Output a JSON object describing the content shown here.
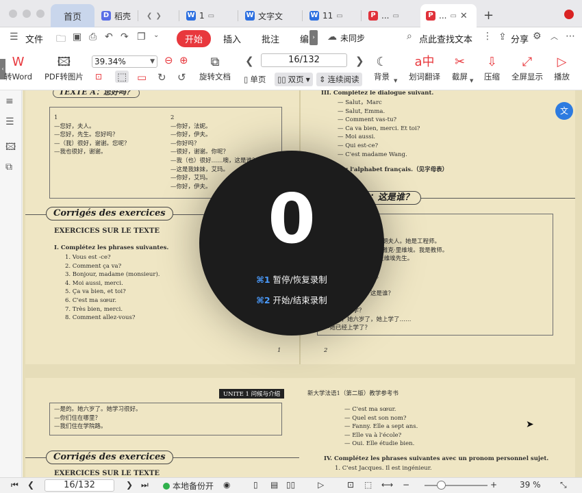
{
  "tabs": {
    "home": "首页",
    "daoke": "稻壳",
    "doc1": "1",
    "doc2": "文字文",
    "doc3": "11",
    "pdf1": "...",
    "pdf2": "...",
    "doc1_badge": "W",
    "doc2_badge": "W",
    "doc3_badge": "W",
    "pdf1_badge": "P",
    "pdf2_badge": "P",
    "daoke_badge": "D",
    "close": "✕",
    "new_tab": "+"
  },
  "menubar": {
    "file": "文件",
    "start": "开始",
    "insert": "插入",
    "annotate": "批注",
    "edit": "编",
    "sync": "未同步",
    "search": "点此查找文本",
    "share": "分享"
  },
  "ribbon": {
    "to_word": "转Word",
    "pdf_to_image": "PDF转图片",
    "zoom": "39.34%",
    "rotate_doc": "旋转文档",
    "page_indicator": "16/132",
    "single_page": "单页",
    "double_page": "双页",
    "continuous": "连续阅读",
    "background": "背景",
    "translate": "划词翻译",
    "screenshot": "截屏",
    "compress": "压缩",
    "fullscreen": "全屏显示",
    "play": "播放"
  },
  "document": {
    "left": {
      "header": "TEXTE A：您好吗？",
      "col1": [
        "1",
        "—您好，夫人。",
        "—您好，先生。您好吗？",
        "—（我）很好，谢谢。您呢？",
        "—我也很好，谢谢。"
      ],
      "col2": [
        "2",
        "—你好，法妮。",
        "—你好，伊夫。",
        "—你好吗？",
        "—很好，谢谢。你呢？",
        "—我（也）很好……噢，这是谁？",
        "—这是我妹妹，艾玛。",
        "—你好，艾玛。",
        "—你好，伊夫。"
      ],
      "banner": "Corrigés des exercices",
      "section": "EXERCICES SUR LE TEXTE",
      "exercise_title": "I.   Complétez les phrases suivantes.",
      "items": [
        "1.  Vous est -ce?",
        "2.  Comment ça va?",
        "3. Bonjour, madame (monsieur).",
        "4.  Moi aussi, merci.",
        "5.  Ça va bien, et toi?",
        "6.  C'est ma sœur.",
        "7.  Très bien, merci.",
        "8.  Comment allez-vous?"
      ],
      "page_no": "1"
    },
    "right": {
      "heading": "III.  Complétez le dialogue suivant.",
      "dialogue": [
        "— Salut，Marc",
        "— Salut, Emma.",
        "— Comment vas-tu?",
        "— Ca va bien, merci. Et toi?",
        "— Moi aussi.",
        "— Qui est-ce?",
        "— C'est  madame Wang."
      ],
      "iv": "IV.   Lisez l'alphabet français.（见字母表）",
      "banner": "TEXTE B：这是谁？",
      "box_lines": [
        "1",
        "—这是谁？",
        "—这是……（夫人）杜朗夫人。她是工程师。",
        "—这是谁？（这）是玛雅克·里维埃。我是教师。",
        "—你好，她是玛雅克·里维埃先生。",
        "2",
        "—您好，先生。你好。",
        "—请问，这是谁？",
        "—这是……（是）这是谁？",
        "—她是学……",
        "—她是什么学？",
        "—是的，她六岁了，她上学了……",
        "—她已经上学了？"
      ],
      "page_no": "2"
    },
    "lower": {
      "unit": "UNITE 1   问候与介绍",
      "book": "新大学法语1（第二版）教学参考书",
      "box_lines": [
        "—是的。她六岁了。她学习很好。",
        "—你们住在哪里？",
        "—我们住在学院路。"
      ],
      "banner": "Corrigés des exercices",
      "section": "EXERCICES SUR LE TEXTE",
      "right_lines": [
        "— C'est ma sœur.",
        "— Quel est son nom?",
        "— Fanny. Elle a sept ans.",
        "— Elle va à l'école?",
        "— Oui. Elle étudie bien."
      ],
      "iv": "IV.  Complétez les phrases suivantes avec un pronom personnel sujet.",
      "iv1": "1.  C'est Jacques. Il est ingénieur."
    }
  },
  "overlay": {
    "countdown": "0",
    "shortcut1_key": "⌘1",
    "shortcut1_label": "暂停/恢复录制",
    "shortcut2_key": "⌘2",
    "shortcut2_label": "开始/结束录制"
  },
  "statusbar": {
    "page": "16/132",
    "backup": "本地备份开",
    "zoom_percent": "39 %"
  },
  "icons": {
    "home_menu": "hamburger-icon",
    "record": "record-dot-icon",
    "translate_float": "translate-float-icon"
  },
  "colors": {
    "accent_red": "#e8383d",
    "word_blue": "#2c6fe0",
    "doc_paper": "#efe6c4",
    "overlay_bg": "#1c1c1c",
    "shortcut_blue": "#4b9cff"
  }
}
